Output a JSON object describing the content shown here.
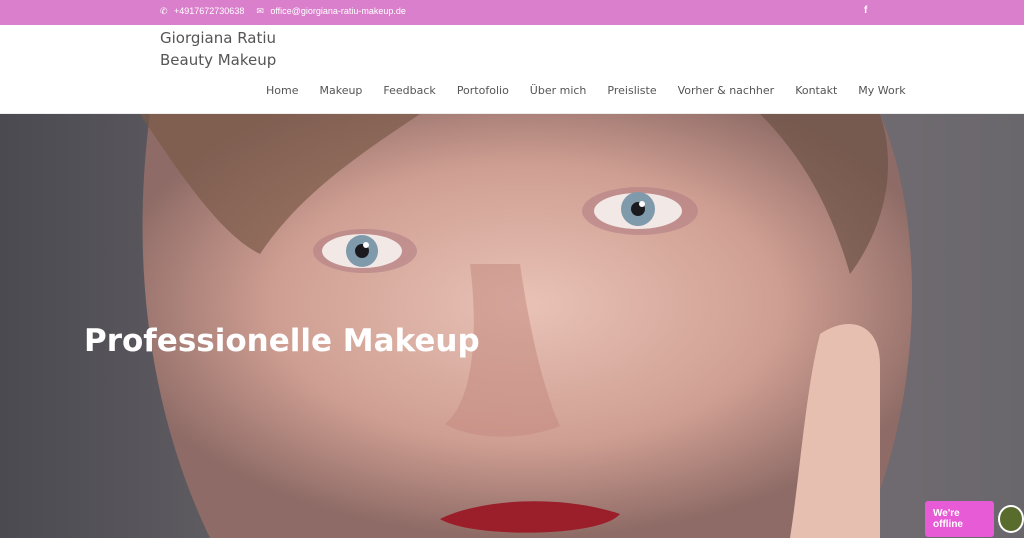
{
  "topbar": {
    "phone": "+4917672730638",
    "email": "office@giorgiana-ratiu-makeup.de",
    "social": "f"
  },
  "logo": {
    "line1": "Giorgiana Ratiu",
    "line2": "Beauty Makeup"
  },
  "nav": [
    "Home",
    "Makeup",
    "Feedback",
    "Portofolio",
    "Über mich",
    "Preisliste",
    "Vorher & nachher",
    "Kontakt",
    "My Work"
  ],
  "hero": {
    "title": "Professionelle Makeup"
  },
  "chat": {
    "label": "We're offline"
  },
  "colors": {
    "topbar": "#d97fcb",
    "chat_badge": "#e85bd6"
  }
}
